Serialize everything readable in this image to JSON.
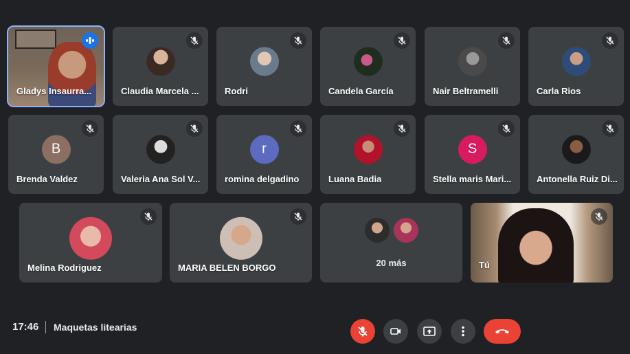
{
  "participants": [
    {
      "name": "Gladys Insaurra...",
      "state": "speaking",
      "kind": "video"
    },
    {
      "name": "Claudia Marcela ...",
      "muted": true,
      "avatar": "photo"
    },
    {
      "name": "Rodri",
      "muted": true,
      "avatar": "photo"
    },
    {
      "name": "Candela García",
      "muted": true,
      "avatar": "photo"
    },
    {
      "name": "Nair Beltramelli",
      "muted": true,
      "avatar": "photo"
    },
    {
      "name": "Carla Rios",
      "muted": true,
      "avatar": "photo"
    },
    {
      "name": "Brenda Valdez",
      "muted": true,
      "initial": "B",
      "color": "#8d6e63"
    },
    {
      "name": "Valeria Ana Sol V...",
      "muted": true,
      "avatar": "photo"
    },
    {
      "name": "romina delgadino",
      "muted": true,
      "initial": "r",
      "color": "#5c6bc0"
    },
    {
      "name": "Luana Badia",
      "muted": true,
      "avatar": "photo"
    },
    {
      "name": "Stella maris Mari...",
      "muted": true,
      "initial": "S",
      "color": "#d81b60"
    },
    {
      "name": "Antonella Ruiz Di...",
      "muted": true,
      "avatar": "photo"
    },
    {
      "name": "Melina Rodriguez",
      "muted": true,
      "avatar": "photo"
    },
    {
      "name": "MARIA BELEN BORGO",
      "muted": true,
      "avatar": "photo"
    },
    {
      "more_label": "20 más"
    },
    {
      "name": "Tú",
      "muted": true,
      "kind": "video"
    }
  ],
  "footer": {
    "time": "17:46",
    "meeting_title": "Maquetas litearias"
  },
  "controls": {
    "mic": "mic-off-icon",
    "camera": "videocam-icon",
    "present": "present-screen-icon",
    "more": "more-vert-icon",
    "leave": "call-end-icon"
  },
  "colors": {
    "background": "#202124",
    "tile": "#3c4043",
    "danger": "#ea4335",
    "speaking_outline": "#8ab4f8"
  }
}
